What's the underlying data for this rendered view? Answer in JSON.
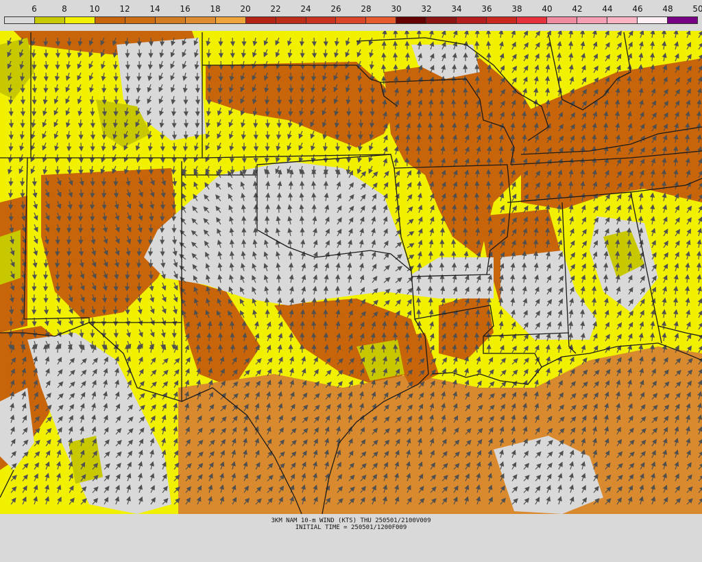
{
  "legend": {
    "labels": [
      "6",
      "8",
      "10",
      "12",
      "14",
      "16",
      "18",
      "20",
      "22",
      "24",
      "26",
      "28",
      "30",
      "32",
      "34",
      "36",
      "38",
      "40",
      "42",
      "44",
      "46",
      "48",
      "50"
    ],
    "colors": [
      "#d9d9d9",
      "#c8c800",
      "#f0f000",
      "#c8640a",
      "#cd6e14",
      "#d27d23",
      "#e08c32",
      "#f0a43c",
      "#b42314",
      "#be2d19",
      "#c8321e",
      "#dc4628",
      "#e65a2d",
      "#640000",
      "#8c1414",
      "#b41e1e",
      "#c8281e",
      "#e6323c",
      "#f08ca0",
      "#f5a0b4",
      "#fab4c3",
      "#fff0f5",
      "#780082"
    ]
  },
  "map": {
    "colors": {
      "calm": "#d9d9d9",
      "light": "#c8c800",
      "moderate": "#f0f000",
      "fresh": "#c8640a",
      "strong": "#d98a2e",
      "gale": "#b42314",
      "border": "#1a1a1a",
      "arrow": "#505050"
    },
    "arrow_icon": "wind-arrow-icon"
  },
  "caption": {
    "line1": "3KM NAM 10-m WIND (KTS) THU 250501/2100V009",
    "line2": "INITIAL TIME = 250501/1200F009"
  }
}
